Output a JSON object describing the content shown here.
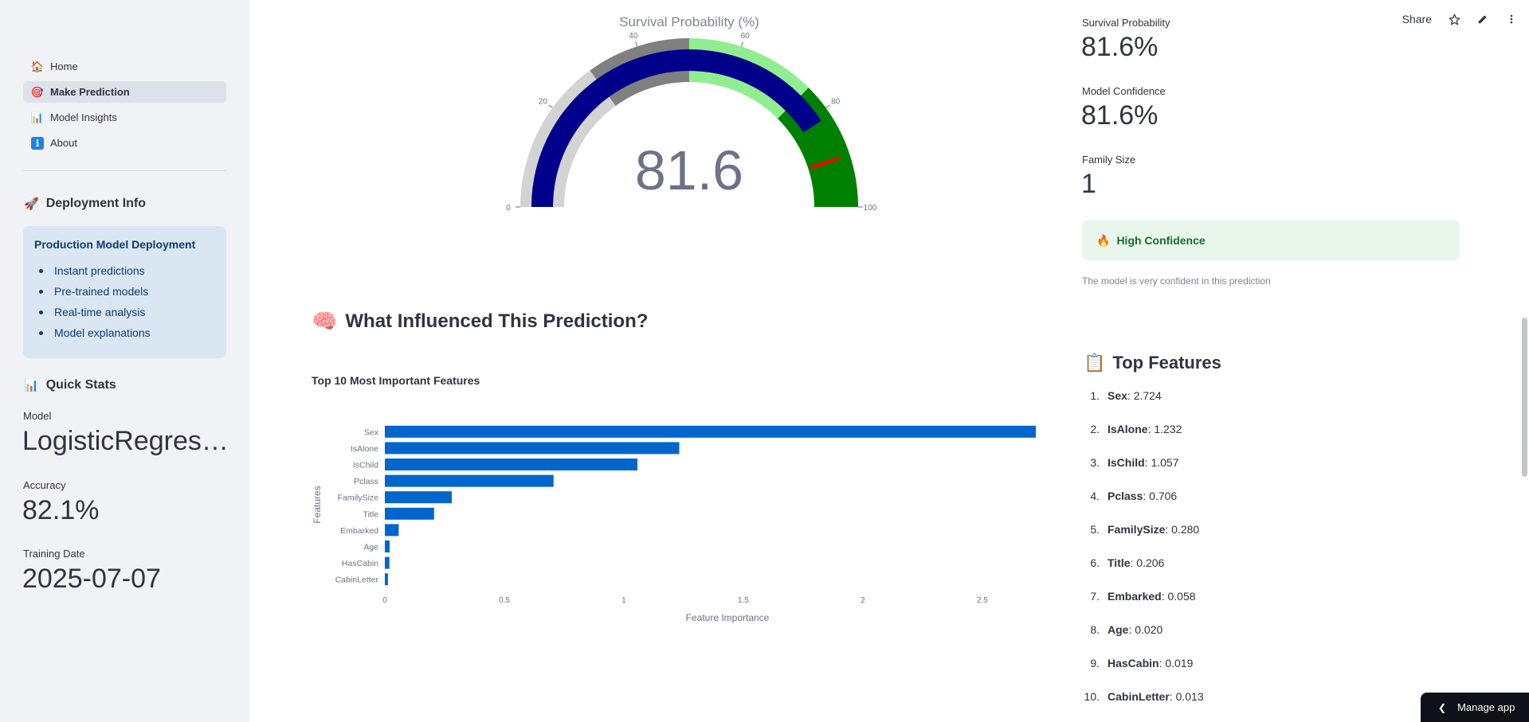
{
  "sidebar": {
    "nav": [
      {
        "label": "Home",
        "icon": "house-icon",
        "glyph": "🏠",
        "active": false
      },
      {
        "label": "Make Prediction",
        "icon": "target-icon",
        "glyph": "🎯",
        "active": true
      },
      {
        "label": "Model Insights",
        "icon": "bar-chart-icon",
        "glyph": "📊",
        "active": false
      },
      {
        "label": "About",
        "icon": "info-icon",
        "glyph": "ℹ",
        "active": false
      }
    ],
    "deployment_heading": "Deployment Info",
    "deployment_icon": "🚀",
    "info_box": {
      "title": "Production Model Deployment",
      "items": [
        "Instant predictions",
        "Pre-trained models",
        "Real-time analysis",
        "Model explanations"
      ]
    },
    "quick_stats_heading": "Quick Stats",
    "quick_stats_icon": "📊",
    "stats": {
      "model_label": "Model",
      "model_value": "LogisticRegression",
      "accuracy_label": "Accuracy",
      "accuracy_value": "82.1%",
      "date_label": "Training Date",
      "date_value": "2025-07-07"
    }
  },
  "gauge": {
    "title": "Survival Probability (%)",
    "value": 81.6,
    "value_text": "81.6",
    "min": 0,
    "max": 100,
    "ticks": [
      0,
      20,
      40,
      60,
      80,
      100
    ],
    "threshold": 90,
    "bands": [
      {
        "from": 0,
        "to": 30,
        "color": "#d3d3d3"
      },
      {
        "from": 30,
        "to": 50,
        "color": "#808080"
      },
      {
        "from": 50,
        "to": 75,
        "color": "#90ee90"
      },
      {
        "from": 75,
        "to": 100,
        "color": "#008000"
      }
    ],
    "bar_color": "#00008b",
    "threshold_color": "#ff0000"
  },
  "section_title": "What Influenced This Prediction?",
  "section_icon": "🧠",
  "chart_data": {
    "type": "bar",
    "orientation": "horizontal",
    "title": "Top 10 Most Important Features",
    "xlabel": "Feature Importance",
    "ylabel": "Features",
    "categories": [
      "Sex",
      "IsAlone",
      "IsChild",
      "Pclass",
      "FamilySize",
      "Title",
      "Embarked",
      "Age",
      "HasCabin",
      "CabinLetter"
    ],
    "values": [
      2.724,
      1.232,
      1.057,
      0.706,
      0.28,
      0.206,
      0.058,
      0.02,
      0.019,
      0.013
    ],
    "xticks": [
      0,
      0.5,
      1,
      1.5,
      2,
      2.5
    ],
    "xtick_labels": [
      "0",
      "0.5",
      "1",
      "1.5",
      "2",
      "2.5"
    ],
    "xlim": [
      0,
      2.724
    ],
    "color": "#0066cc"
  },
  "right": {
    "survival_label": "Survival Probability",
    "survival_value": "81.6%",
    "confidence_label": "Model Confidence",
    "confidence_value": "81.6%",
    "family_label": "Family Size",
    "family_value": "1",
    "confidence_badge": "High Confidence",
    "confidence_badge_icon": "🔥",
    "confidence_caption": "The model is very confident in this prediction",
    "top_features_heading": "Top Features",
    "top_features_icon": "📋",
    "top_features": [
      {
        "num": "1.",
        "name": "Sex",
        "value": ": 2.724"
      },
      {
        "num": "2.",
        "name": "IsAlone",
        "value": ": 1.232"
      },
      {
        "num": "3.",
        "name": "IsChild",
        "value": ": 1.057"
      },
      {
        "num": "4.",
        "name": "Pclass",
        "value": ": 0.706"
      },
      {
        "num": "5.",
        "name": "FamilySize",
        "value": ": 0.280"
      },
      {
        "num": "6.",
        "name": "Title",
        "value": ": 0.206"
      },
      {
        "num": "7.",
        "name": "Embarked",
        "value": ": 0.058"
      },
      {
        "num": "8.",
        "name": "Age",
        "value": ": 0.020"
      },
      {
        "num": "9.",
        "name": "HasCabin",
        "value": ": 0.019"
      },
      {
        "num": "10.",
        "name": "CabinLetter",
        "value": ": 0.013"
      }
    ]
  },
  "toolbar": {
    "share_label": "Share"
  },
  "manage_app": {
    "label": "Manage app"
  }
}
